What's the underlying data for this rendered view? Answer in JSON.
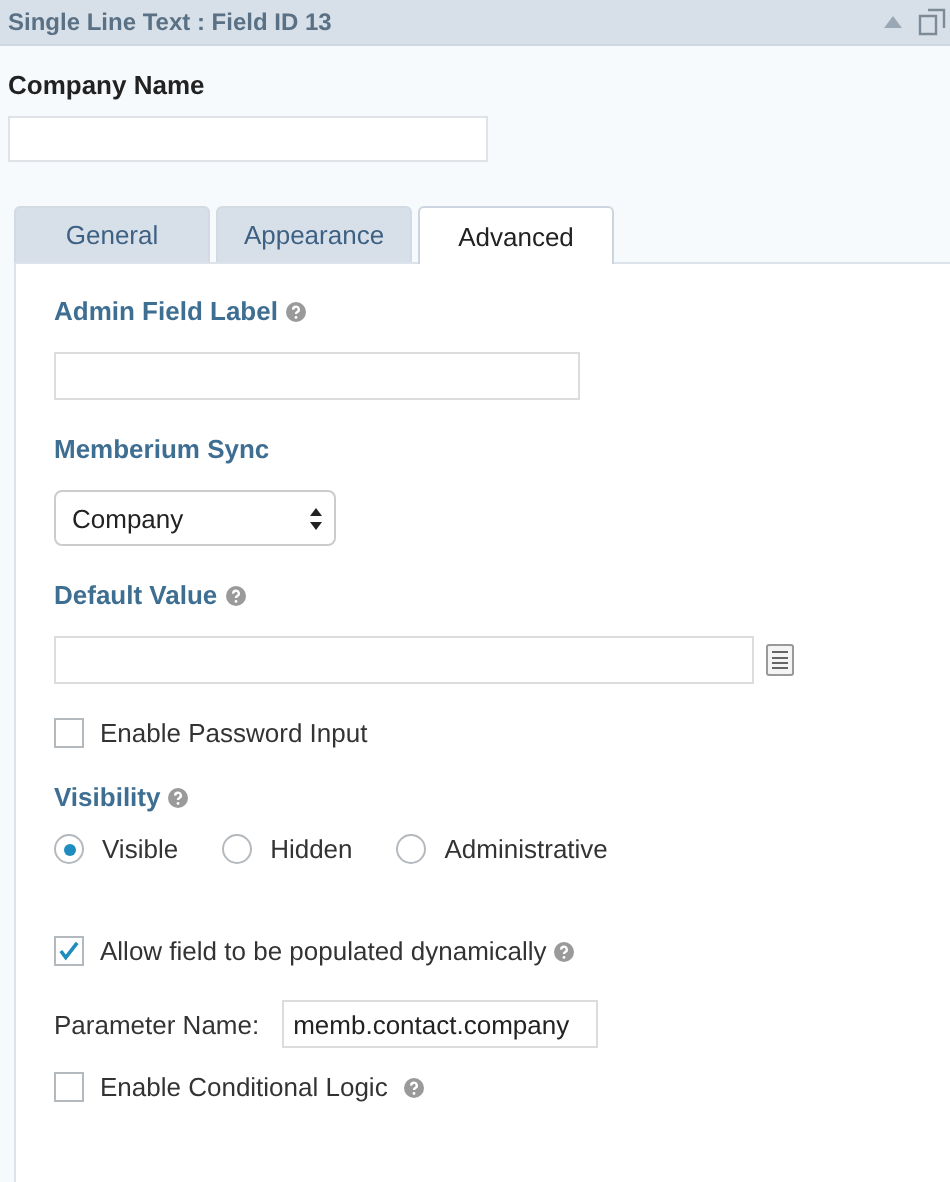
{
  "header": {
    "title": "Single Line Text : Field ID 13"
  },
  "field": {
    "label": "Company Name"
  },
  "tabs": [
    {
      "label": "General",
      "selected": false
    },
    {
      "label": "Appearance",
      "selected": false
    },
    {
      "label": "Advanced",
      "selected": true
    }
  ],
  "admin_field_label": {
    "label": "Admin Field Label"
  },
  "memberium_sync": {
    "label": "Memberium Sync",
    "value": "Company"
  },
  "default_value": {
    "label": "Default Value"
  },
  "password_input": {
    "label": "Enable Password Input",
    "checked": false
  },
  "visibility": {
    "label": "Visibility",
    "options": [
      {
        "label": "Visible",
        "selected": true
      },
      {
        "label": "Hidden",
        "selected": false
      },
      {
        "label": "Administrative",
        "selected": false
      }
    ]
  },
  "dynamic_population": {
    "label": "Allow field to be populated dynamically",
    "checked": true,
    "parameter_label": "Parameter Name:",
    "parameter_value": "memb.contact.company"
  },
  "conditional_logic": {
    "label": "Enable Conditional Logic",
    "checked": false
  }
}
